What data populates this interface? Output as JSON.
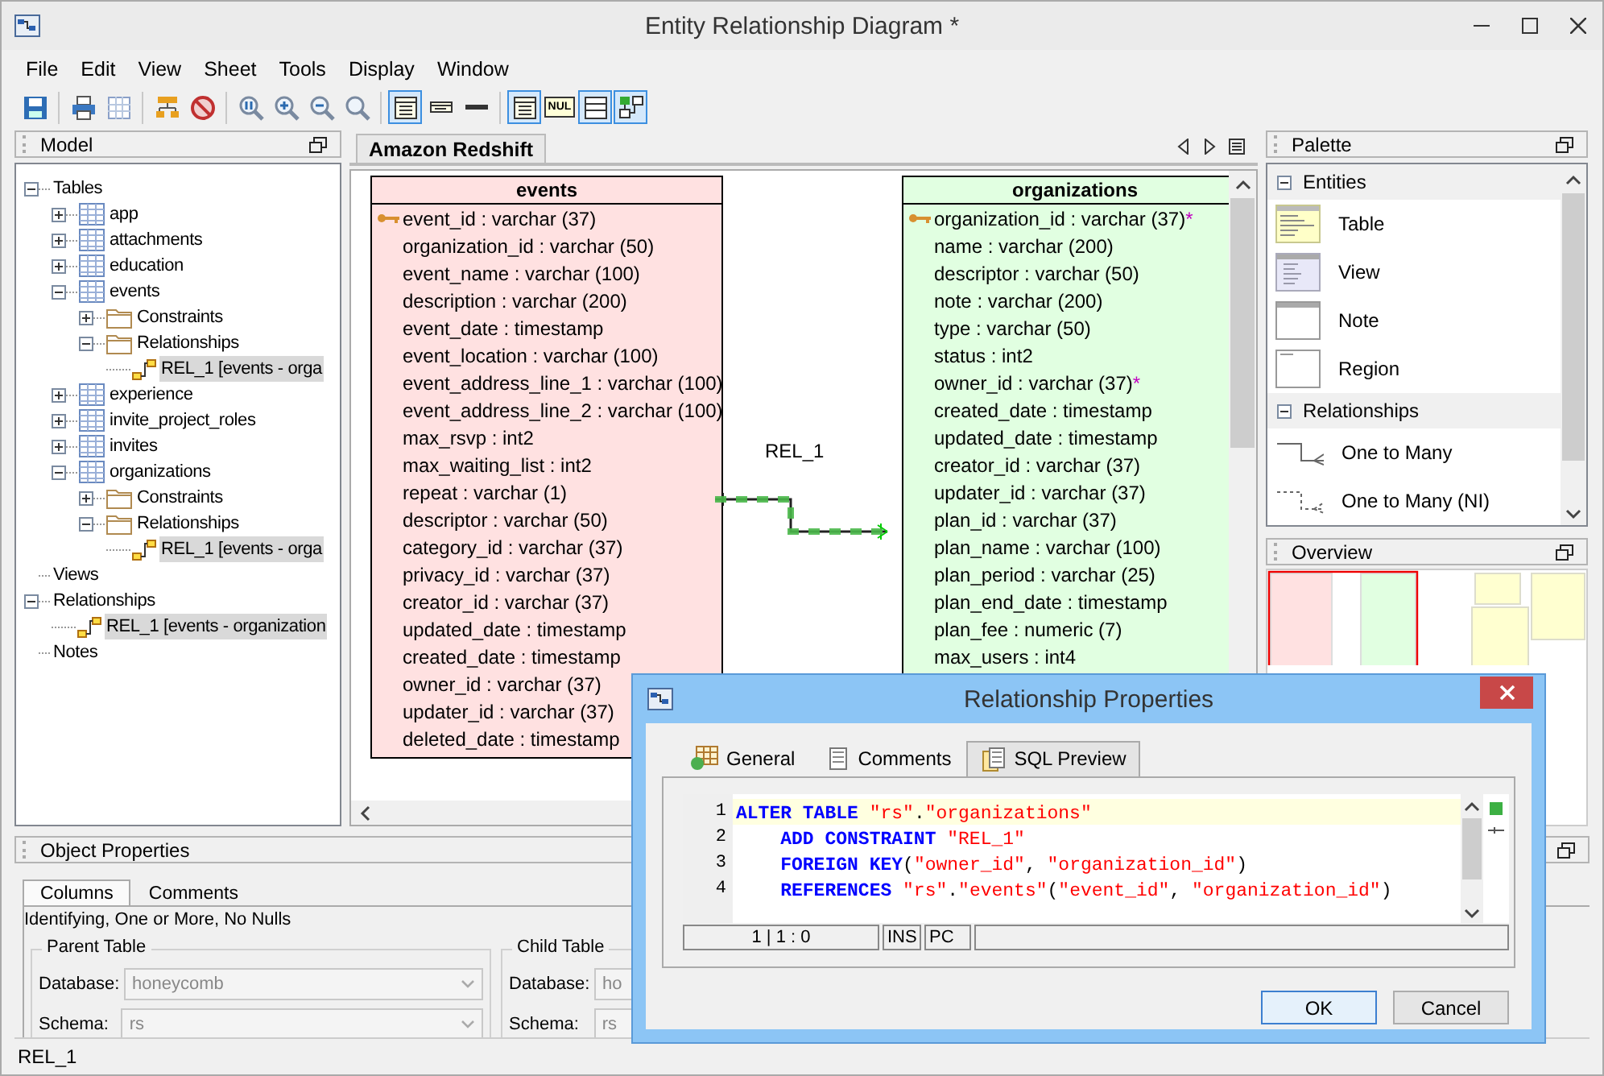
{
  "window": {
    "title": "Entity Relationship Diagram *"
  },
  "menu": [
    "File",
    "Edit",
    "View",
    "Sheet",
    "Tools",
    "Display",
    "Window"
  ],
  "toolbar": [
    {
      "kind": "save",
      "selected": false
    },
    {
      "kind": "separator"
    },
    {
      "kind": "print",
      "selected": false
    },
    {
      "kind": "grid",
      "selected": false
    },
    {
      "kind": "separator"
    },
    {
      "kind": "layout",
      "selected": false
    },
    {
      "kind": "stop",
      "selected": false
    },
    {
      "kind": "separator"
    },
    {
      "kind": "zoom-fit",
      "selected": false
    },
    {
      "kind": "zoom-in",
      "selected": false
    },
    {
      "kind": "zoom-out",
      "selected": false
    },
    {
      "kind": "zoom",
      "selected": false
    },
    {
      "kind": "separator"
    },
    {
      "kind": "detail",
      "selected": true
    },
    {
      "kind": "names",
      "selected": false
    },
    {
      "kind": "line",
      "selected": false
    },
    {
      "kind": "separator"
    },
    {
      "kind": "table",
      "selected": true
    },
    {
      "kind": "nul",
      "label": "NUL",
      "selected": false
    },
    {
      "kind": "attributes",
      "selected": true
    },
    {
      "kind": "relation",
      "selected": true
    }
  ],
  "model": {
    "title": "Model",
    "tree": [
      {
        "label": "Tables",
        "expanded": true,
        "selected": false,
        "children": [
          {
            "label": "app",
            "kind": "table",
            "expanded": false,
            "selected": false
          },
          {
            "label": "attachments",
            "kind": "table",
            "expanded": false,
            "selected": false
          },
          {
            "label": "education",
            "kind": "table",
            "expanded": false,
            "selected": false
          },
          {
            "label": "events",
            "kind": "table",
            "expanded": true,
            "selected": false,
            "children": [
              {
                "label": "Constraints",
                "kind": "folder",
                "expanded": false,
                "selected": false
              },
              {
                "label": "Relationships",
                "kind": "folder",
                "expanded": true,
                "selected": false,
                "children": [
                  {
                    "label": "REL_1 [events - orga",
                    "kind": "relationship",
                    "selected": true
                  }
                ]
              }
            ]
          },
          {
            "label": "experience",
            "kind": "table",
            "expanded": false,
            "selected": false
          },
          {
            "label": "invite_project_roles",
            "kind": "table",
            "expanded": false,
            "selected": false
          },
          {
            "label": "invites",
            "kind": "table",
            "expanded": false,
            "selected": false
          },
          {
            "label": "organizations",
            "kind": "table",
            "expanded": true,
            "selected": false,
            "children": [
              {
                "label": "Constraints",
                "kind": "folder",
                "expanded": false,
                "selected": false
              },
              {
                "label": "Relationships",
                "kind": "folder",
                "expanded": true,
                "selected": false,
                "children": [
                  {
                    "label": "REL_1 [events - orga",
                    "kind": "relationship",
                    "selected": true
                  }
                ]
              }
            ]
          }
        ]
      },
      {
        "label": "Views",
        "selected": false
      },
      {
        "label": "Relationships",
        "expanded": true,
        "selected": false,
        "children": [
          {
            "label": "REL_1 [events - organization",
            "kind": "relationship",
            "selected": true
          }
        ]
      },
      {
        "label": "Notes",
        "selected": false
      }
    ]
  },
  "diagram": {
    "tab": {
      "label": "Amazon Redshift",
      "selected": true
    },
    "entities": [
      {
        "name": "events",
        "color": "#ffe1e1",
        "columns": [
          {
            "text": "event_id : varchar (37)",
            "key": true
          },
          {
            "text": "organization_id : varchar (50)",
            "key": false
          },
          {
            "text": "event_name : varchar (100)",
            "key": false
          },
          {
            "text": "description : varchar (200)",
            "key": false
          },
          {
            "text": "event_date : timestamp",
            "key": false
          },
          {
            "text": "event_location : varchar (100)",
            "key": false
          },
          {
            "text": "event_address_line_1 : varchar (100)",
            "key": false
          },
          {
            "text": "event_address_line_2 : varchar (100)",
            "key": false
          },
          {
            "text": "max_rsvp : int2",
            "key": false
          },
          {
            "text": "max_waiting_list : int2",
            "key": false
          },
          {
            "text": "repeat : varchar (1)",
            "key": false
          },
          {
            "text": "descriptor : varchar (50)",
            "key": false
          },
          {
            "text": "category_id : varchar (37)",
            "key": false
          },
          {
            "text": "privacy_id : varchar (37)",
            "key": false
          },
          {
            "text": "creator_id : varchar (37)",
            "key": false
          },
          {
            "text": "updated_date : timestamp",
            "key": false
          },
          {
            "text": "created_date : timestamp",
            "key": false
          },
          {
            "text": "owner_id : varchar (37)",
            "key": false
          },
          {
            "text": "updater_id : varchar (37)",
            "key": false
          },
          {
            "text": "deleted_date : timestamp",
            "key": false
          }
        ]
      },
      {
        "name": "organizations",
        "color": "#e1ffe1",
        "columns": [
          {
            "text": "organization_id : varchar (37)",
            "key": true,
            "marker": "*"
          },
          {
            "text": "name : varchar (200)",
            "key": false
          },
          {
            "text": "descriptor : varchar (50)",
            "key": false
          },
          {
            "text": "note : varchar (200)",
            "key": false
          },
          {
            "text": "type : varchar (50)",
            "key": false
          },
          {
            "text": "status : int2",
            "key": false
          },
          {
            "text": "owner_id : varchar (37)",
            "key": false,
            "marker": "*"
          },
          {
            "text": "created_date : timestamp",
            "key": false
          },
          {
            "text": "updated_date : timestamp",
            "key": false
          },
          {
            "text": "creator_id : varchar (37)",
            "key": false
          },
          {
            "text": "updater_id : varchar (37)",
            "key": false
          },
          {
            "text": "plan_id : varchar (37)",
            "key": false
          },
          {
            "text": "plan_name : varchar (100)",
            "key": false
          },
          {
            "text": "plan_period : varchar (25)",
            "key": false
          },
          {
            "text": "plan_end_date : timestamp",
            "key": false
          },
          {
            "text": "plan_fee : numeric (7)",
            "key": false
          },
          {
            "text": "max_users : int4",
            "key": false
          }
        ]
      }
    ],
    "relationship": {
      "label": "REL_1",
      "selected": true
    }
  },
  "palette": {
    "title": "Palette",
    "sections": [
      {
        "label": "Entities",
        "expanded": true,
        "items": [
          {
            "label": "Table",
            "kind": "table"
          },
          {
            "label": "View",
            "kind": "view"
          },
          {
            "label": "Note",
            "kind": "note"
          },
          {
            "label": "Region",
            "kind": "region"
          }
        ]
      },
      {
        "label": "Relationships",
        "expanded": true,
        "items": [
          {
            "label": "One to Many",
            "kind": "one-to-many"
          },
          {
            "label": "One to Many (NI)",
            "kind": "one-to-many-ni"
          }
        ]
      }
    ]
  },
  "overview": {
    "title": "Overview"
  },
  "object_properties": {
    "title": "Object Properties",
    "tabs": [
      {
        "label": "Columns",
        "selected": true
      },
      {
        "label": "Comments",
        "selected": false
      }
    ],
    "summary": "Identifying, One or More, No Nulls",
    "groups": [
      {
        "title": "Parent Table",
        "fields": [
          {
            "label": "Database:",
            "value": "honeycomb",
            "disabled": true
          },
          {
            "label": "Schema:",
            "value": "rs",
            "disabled": true
          }
        ]
      },
      {
        "title": "Child Table",
        "fields": [
          {
            "label": "Database:",
            "value": "ho",
            "disabled": true
          },
          {
            "label": "Schema:",
            "value": "rs",
            "disabled": true
          }
        ]
      }
    ]
  },
  "status_bar": "REL_1",
  "dialog": {
    "title": "Relationship Properties",
    "tabs": [
      {
        "label": "General",
        "kind": "general",
        "selected": false
      },
      {
        "label": "Comments",
        "kind": "comments",
        "selected": false
      },
      {
        "label": "SQL Preview",
        "kind": "sql",
        "selected": true
      }
    ],
    "editor": {
      "lines": [
        {
          "number": "1",
          "current": true,
          "tokens": [
            {
              "kind": "keyword",
              "text": "ALTER TABLE "
            },
            {
              "kind": "string",
              "text": "\"rs\""
            },
            {
              "kind": "plain",
              "text": "."
            },
            {
              "kind": "string",
              "text": "\"organizations\""
            }
          ]
        },
        {
          "number": "2",
          "current": false,
          "tokens": [
            {
              "kind": "keyword",
              "text": "    ADD CONSTRAINT "
            },
            {
              "kind": "string",
              "text": "\"REL_1\""
            }
          ]
        },
        {
          "number": "3",
          "current": false,
          "tokens": [
            {
              "kind": "keyword",
              "text": "    FOREIGN KEY"
            },
            {
              "kind": "plain",
              "text": "("
            },
            {
              "kind": "string",
              "text": "\"owner_id\""
            },
            {
              "kind": "plain",
              "text": ", "
            },
            {
              "kind": "string",
              "text": "\"organization_id\""
            },
            {
              "kind": "plain",
              "text": ")"
            }
          ]
        },
        {
          "number": "4",
          "current": false,
          "tokens": [
            {
              "kind": "keyword",
              "text": "    REFERENCES "
            },
            {
              "kind": "string",
              "text": "\"rs\""
            },
            {
              "kind": "plain",
              "text": "."
            },
            {
              "kind": "string",
              "text": "\"events\""
            },
            {
              "kind": "plain",
              "text": "("
            },
            {
              "kind": "string",
              "text": "\"event_id\""
            },
            {
              "kind": "plain",
              "text": ", "
            },
            {
              "kind": "string",
              "text": "\"organization_id\""
            },
            {
              "kind": "plain",
              "text": ")"
            }
          ]
        }
      ],
      "status": [
        "1 | 1 : 0",
        "INS",
        "PC"
      ]
    },
    "buttons": [
      {
        "label": "OK",
        "default": true
      },
      {
        "label": "Cancel",
        "default": false
      }
    ]
  }
}
